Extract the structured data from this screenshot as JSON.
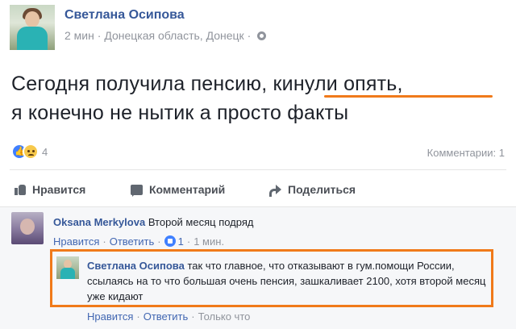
{
  "post": {
    "author": "Светлана Осипова",
    "time": "2 мин",
    "location": "Донецкая область, Донецк",
    "text_line1": "Сегодня получила пенсию, кинули опять,",
    "text_line2": "я конечно не нытик а просто факты",
    "reaction_count": "4",
    "comments_count": "Комментарии: 1",
    "reaction_icons": [
      "like-icon",
      "sad-icon"
    ],
    "highlight_color": "#f07a1a"
  },
  "actions": {
    "like": "Нравится",
    "comment": "Комментарий",
    "share": "Поделиться"
  },
  "comments": [
    {
      "author": "Oksana Merkylova",
      "text": "Второй месяц подряд",
      "like": "Нравится",
      "reply": "Ответить",
      "likes": "1",
      "time": "1 мин."
    },
    {
      "author": "Светлана Осипова",
      "text": "так что главное, что отказывают в гум.помощи России, ссылаясь на то что большая очень пенсия, зашкаливает 2100, хотя второй месяц уже кидают",
      "like": "Нравится",
      "reply": "Ответить",
      "time": "Только что"
    }
  ]
}
